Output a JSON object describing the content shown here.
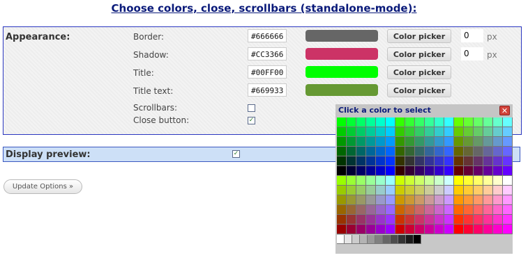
{
  "page": {
    "title": "Choose colors, close, scrollbars (standalone-mode):"
  },
  "appearance": {
    "label": "Appearance:",
    "rows": [
      {
        "label": "Border:",
        "hex": "#666666",
        "color": "#666666",
        "button": "Color picker",
        "size": "0",
        "unit": "px"
      },
      {
        "label": "Shadow:",
        "hex": "#CC3366",
        "color": "#CC3366",
        "button": "Color picker",
        "size": "0",
        "unit": "px"
      },
      {
        "label": "Title:",
        "hex": "#00FF00",
        "color": "#00FF00",
        "button": "Color picker"
      },
      {
        "label": "Title text:",
        "hex": "#669933",
        "color": "#669933",
        "button": "Color picker"
      }
    ],
    "scrollbars": {
      "label": "Scrollbars:",
      "checked": false
    },
    "close_button": {
      "label": "Close button:",
      "checked": true
    }
  },
  "display_preview": {
    "label": "Display preview:",
    "checked": true
  },
  "update_button": {
    "label": "Update Options »"
  },
  "color_popup": {
    "title": "Click a color to select",
    "close_icon": "close-icon"
  }
}
